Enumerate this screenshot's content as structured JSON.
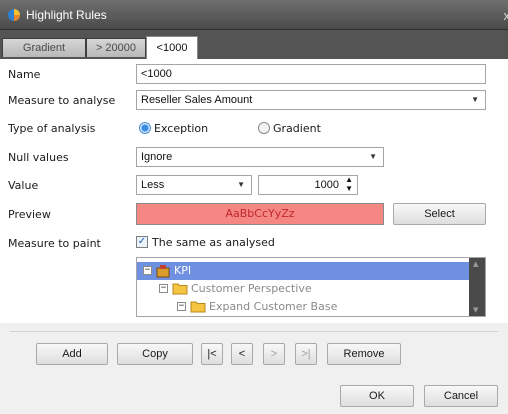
{
  "window": {
    "title": "Highlight Rules",
    "close_glyph": "x",
    "icon": "highlight-rules-app-icon"
  },
  "tabs": [
    {
      "label": "Gradient",
      "active": false
    },
    {
      "label": "> 20000",
      "active": false
    },
    {
      "label": "<1000",
      "active": true
    }
  ],
  "form": {
    "name_label": "Name",
    "name_value": "<1000",
    "measure_label": "Measure to analyse",
    "measure_value": "Reseller Sales Amount",
    "analysis_label": "Type of analysis",
    "analysis_options": [
      {
        "label": "Exception",
        "selected": true
      },
      {
        "label": "Gradient",
        "selected": false
      }
    ],
    "null_label": "Null values",
    "null_value": "Ignore",
    "value_label": "Value",
    "operator_value": "Less",
    "number_value": "1000",
    "preview_label": "Preview",
    "preview_text": "AaBbCcYyZz",
    "select_button": "Select",
    "paint_label": "Measure to paint",
    "paint_checkbox_label": "The same as analysed",
    "paint_checked": true
  },
  "tree": {
    "items": [
      {
        "label": "KPI",
        "selected": true,
        "expanded": true,
        "icon": "kpi-cube-icon"
      },
      {
        "label": "Customer Perspective",
        "selected": false,
        "expanded": true,
        "icon": "folder-icon"
      },
      {
        "label": "Expand Customer Base",
        "selected": false,
        "expanded": true,
        "icon": "folder-icon"
      }
    ]
  },
  "toolbar": {
    "add": "Add",
    "copy": "Copy",
    "first": "|<",
    "prev": "<",
    "next": ">",
    "last": ">|",
    "remove": "Remove"
  },
  "dialog": {
    "ok": "OK",
    "cancel": "Cancel"
  },
  "colors": {
    "preview_background": "#f48684",
    "preview_text": "#c1282a",
    "selection": "#6f8fe0",
    "titlebar": "#5a5a5a"
  }
}
